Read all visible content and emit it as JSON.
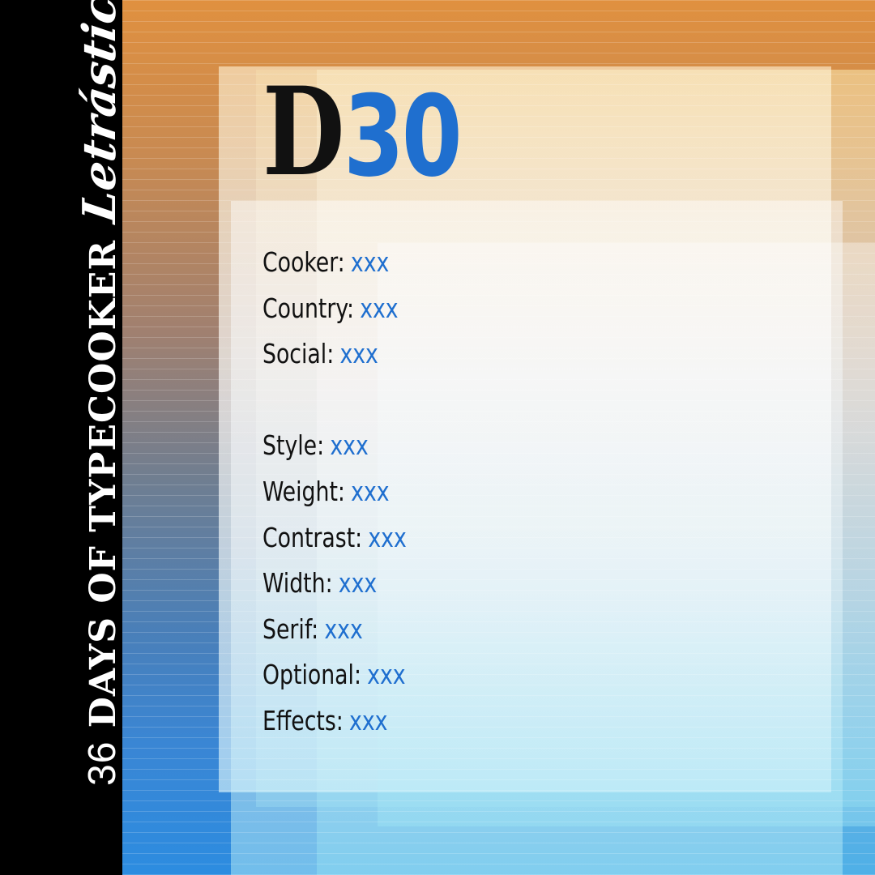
{
  "sidebar": {
    "number": "36",
    "title": "DAYS OF TYPECOOKER",
    "logo": "Letrástica"
  },
  "header": {
    "letter": "D",
    "number": "30"
  },
  "info_fields": [
    {
      "label": "Cooker:",
      "value": "xxx"
    },
    {
      "label": "Country:",
      "value": "xxx"
    },
    {
      "label": "Social:",
      "value": "xxx"
    }
  ],
  "style_fields": [
    {
      "label": "Style:",
      "value": "xxx"
    },
    {
      "label": "Weight:",
      "value": "xxx"
    },
    {
      "label": "Contrast:",
      "value": "xxx"
    },
    {
      "label": "Width:",
      "value": "xxx"
    },
    {
      "label": "Serif:",
      "value": "xxx"
    },
    {
      "label": "Optional:",
      "value": "xxx"
    },
    {
      "label": "Effects:",
      "value": "xxx"
    }
  ],
  "colors": {
    "accent": "#1f6fcf",
    "text": "#111111",
    "sidebar": "#000000",
    "gradient_top": "#e0903f",
    "gradient_bottom": "#2c8ce0"
  }
}
